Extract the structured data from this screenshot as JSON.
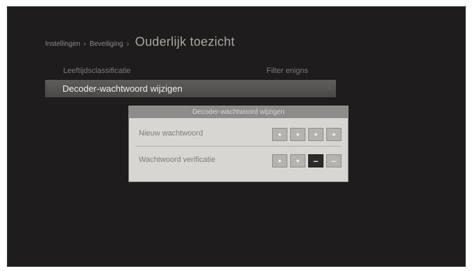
{
  "breadcrumb": {
    "crumb1": "Instellingen",
    "sep1": "›",
    "crumb2": "Beveiliging",
    "sep2": "›",
    "current": "Ouderlijk toezicht"
  },
  "columns": {
    "left": "Leeftijdsclassificatie",
    "right": "Filter enigns"
  },
  "menu_row": {
    "label": "Decoder-wachtwoord wijzigen",
    "chevron": "‹"
  },
  "dialog": {
    "title": "Decoder-wachtwoord wijzigen",
    "rows": [
      {
        "label": "Nieuw wachtwoord",
        "pins": [
          "•",
          "•",
          "•",
          "•"
        ],
        "active_index": null
      },
      {
        "label": "Wachtwoord verificatie",
        "pins": [
          "•",
          "•",
          "–",
          "–"
        ],
        "active_index": 2
      }
    ]
  }
}
